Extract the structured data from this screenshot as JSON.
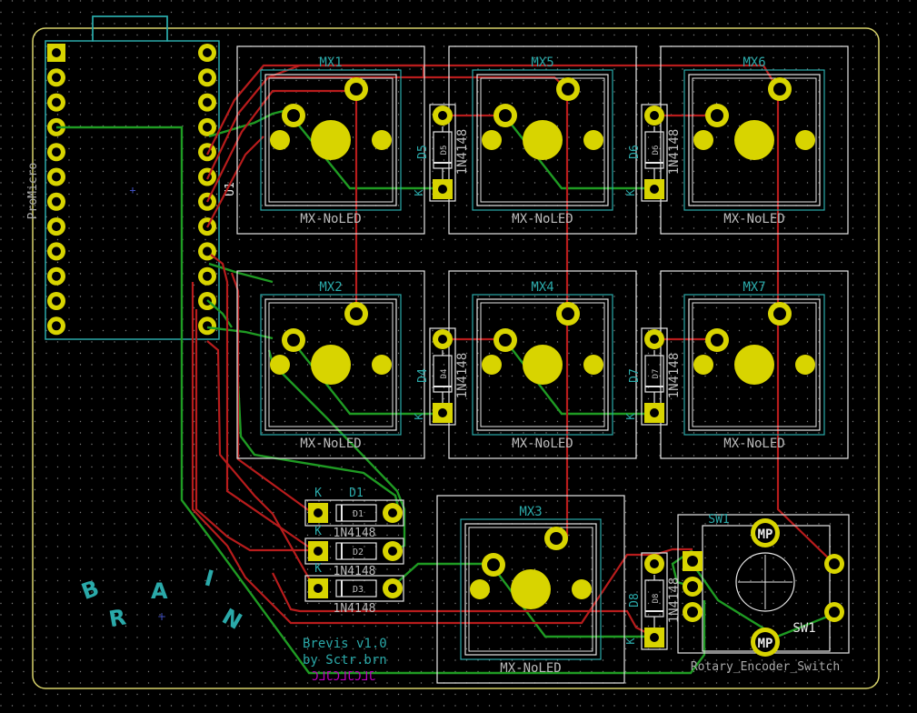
{
  "colors": {
    "background": "#000000",
    "edge_cuts": "#d8d36a",
    "silkscreen": "#e8e8e8",
    "fab": "#2aa9a9",
    "courtyard": "#e6e6e6",
    "pad": "#d8d400",
    "front_copper": "#b81c1c",
    "back_copper": "#1f9b23",
    "grid": "#d0d0d0",
    "back_silk": "#c000c0"
  },
  "promicro": {
    "ref": "U1",
    "value": "ProMicro"
  },
  "switches": [
    {
      "ref": "MX1",
      "value": "MX-NoLED"
    },
    {
      "ref": "MX5",
      "value": "MX-NoLED"
    },
    {
      "ref": "MX6",
      "value": "MX-NoLED"
    },
    {
      "ref": "MX2",
      "value": "MX-NoLED"
    },
    {
      "ref": "MX4",
      "value": "MX-NoLED"
    },
    {
      "ref": "MX7",
      "value": "MX-NoLED"
    },
    {
      "ref": "MX3",
      "value": "MX-NoLED"
    }
  ],
  "diodes_vertical": [
    {
      "ref": "D5",
      "value": "1N4148",
      "pad_k": "K"
    },
    {
      "ref": "D6",
      "value": "1N4148",
      "pad_k": "K"
    },
    {
      "ref": "D4",
      "value": "1N4148",
      "pad_k": "K"
    },
    {
      "ref": "D7",
      "value": "1N4148",
      "pad_k": "K"
    },
    {
      "ref": "D8",
      "value": "1N4148",
      "pad_k": "K"
    }
  ],
  "diodes_horizontal": [
    {
      "ref": "D1",
      "value": "1N4148",
      "pad_k": "K"
    },
    {
      "ref": "D2",
      "value": "1N4148",
      "pad_k": "K"
    },
    {
      "ref": "D3",
      "value": "1N4148",
      "pad_k": "K"
    }
  ],
  "encoder": {
    "ref": "SW1",
    "value": "Rotary_Encoder_Switch",
    "mp_label": "MP"
  },
  "logo_letters": [
    "B",
    "R",
    "A",
    "I",
    "N"
  ],
  "credits": {
    "line1": "Brevis v1.0",
    "line2": "by Sctr.brn",
    "back_text": "JLCJLCJLC"
  }
}
